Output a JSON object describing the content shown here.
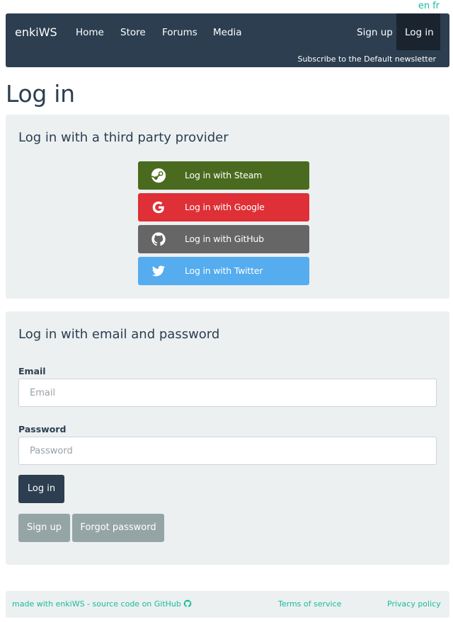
{
  "lang": {
    "en": "en",
    "fr": "fr"
  },
  "navbar": {
    "brand": "enkiWS",
    "items": [
      "Home",
      "Store",
      "Forums",
      "Media"
    ],
    "signup": "Sign up",
    "login": "Log in",
    "newsletter": "Subscribe to the Default newsletter"
  },
  "page": {
    "title": "Log in"
  },
  "third_party": {
    "title": "Log in with a third party provider",
    "providers": [
      {
        "label": "Log in with Steam",
        "icon": "steam-icon",
        "color": "#4a6b1f"
      },
      {
        "label": "Log in with Google",
        "icon": "google-icon",
        "color": "#de3036"
      },
      {
        "label": "Log in with GitHub",
        "icon": "github-icon",
        "color": "#666666"
      },
      {
        "label": "Log in with Twitter",
        "icon": "twitter-icon",
        "color": "#55acee"
      }
    ]
  },
  "email_login": {
    "title": "Log in with email and password",
    "email_label": "Email",
    "email_placeholder": "Email",
    "password_label": "Password",
    "password_placeholder": "Password",
    "login_button": "Log in",
    "signup_button": "Sign up",
    "forgot_button": "Forgot password"
  },
  "footer": {
    "made_with": "made with enkiWS - source code on GitHub",
    "terms": "Terms of service",
    "privacy": "Privacy policy"
  },
  "colors": {
    "primary": "#2c3e50",
    "accent": "#18bc9c",
    "card_bg": "#ecf0f1",
    "secondary_btn": "#95a5a6"
  }
}
